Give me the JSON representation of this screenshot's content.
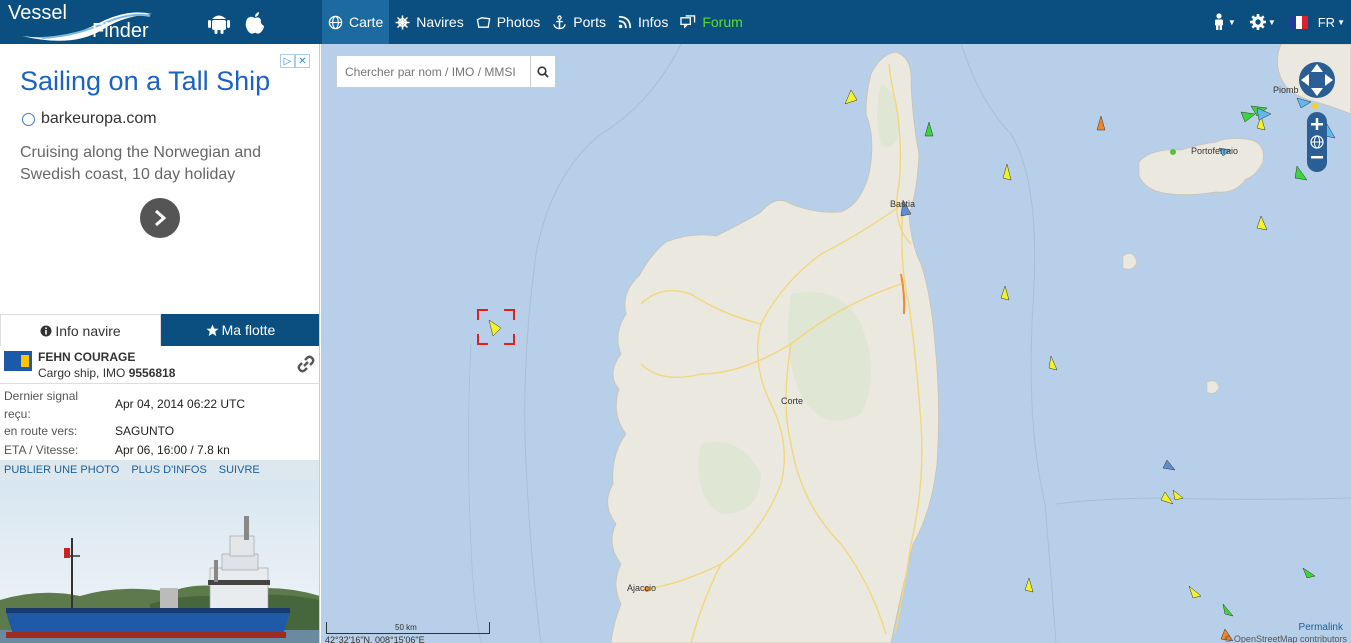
{
  "header": {
    "logo_word1": "Vessel",
    "logo_word2": "Finder",
    "nav": [
      {
        "label": "Carte",
        "icon": "globe-icon"
      },
      {
        "label": "Navires",
        "icon": "helm-icon"
      },
      {
        "label": "Photos",
        "icon": "camera-icon"
      },
      {
        "label": "Ports",
        "icon": "anchor-icon"
      },
      {
        "label": "Infos",
        "icon": "rss-icon"
      },
      {
        "label": "Forum",
        "icon": "chat-icon"
      }
    ],
    "lang": "FR",
    "colors": {
      "bar": "#0a4f80",
      "active": "#1d6aa0",
      "forum": "#5fdc2b"
    }
  },
  "ad": {
    "title": "Sailing on a Tall Ship",
    "domain": "barkeuropa.com",
    "description": "Cruising along the Norwegian and Swedish coast, 10 day holiday"
  },
  "tabs": {
    "info": "Info navire",
    "fleet": "Ma flotte"
  },
  "vessel": {
    "name": "FEHN COURAGE",
    "type_prefix": "Cargo ship, IMO ",
    "imo": "9556818",
    "rows": [
      {
        "label": "Dernier signal reçu:",
        "value": "Apr 04, 2014 06:22 UTC"
      },
      {
        "label": "en route vers:",
        "value": "SAGUNTO"
      },
      {
        "label": "ETA / Vitesse:",
        "value": "Apr 06, 16:00 / 7.8 kn"
      }
    ],
    "actions": [
      "Publier une photo",
      "Plus d'infos",
      "Suivre"
    ]
  },
  "map": {
    "search_placeholder": "Chercher par nom / IMO / MMSI",
    "places": [
      "Bastia",
      "Corte",
      "Ajaccio",
      "Piomb",
      "Portoferraio"
    ],
    "scale": "50 km",
    "coords": "42°32'16\"N, 008°15'06\"E",
    "attribution": "© OpenStreetMap contributors",
    "permalink": "Permalink"
  }
}
